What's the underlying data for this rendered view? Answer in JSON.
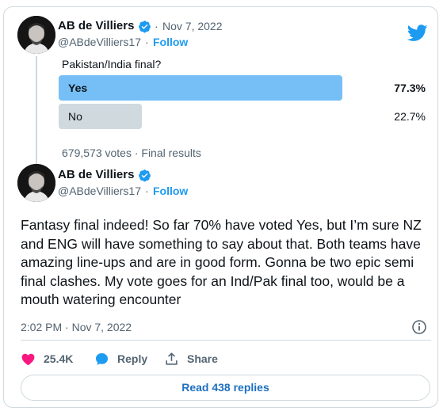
{
  "quoted_tweet": {
    "author_name": "AB de Villiers",
    "handle": "@ABdeVilliers17",
    "date": "Nov 7, 2022",
    "dot": "·",
    "follow_label": "Follow",
    "question": "Pakistan/India final?",
    "poll": {
      "options": [
        {
          "label": "Yes",
          "percent": 77.3,
          "percent_label": "77.3%",
          "winner": true
        },
        {
          "label": "No",
          "percent": 22.7,
          "percent_label": "22.7%",
          "winner": false
        }
      ],
      "votes": "679,573 votes",
      "status": "Final results",
      "meta_line": "679,573 votes · Final results"
    }
  },
  "main_tweet": {
    "author_name": "AB de Villiers",
    "handle": "@ABdeVilliers17",
    "dot": "·",
    "follow_label": "Follow",
    "text": "Fantasy final indeed! So far 70% have voted Yes, but I’m sure NZ and ENG will have something to say about that. Both teams have amazing line-ups and are in good form. Gonna be two epic semi final clashes. My vote goes for an Ind/Pak final too, would be a mouth watering encounter",
    "timestamp": "2:02 PM · Nov 7, 2022"
  },
  "actions": {
    "likes": "25.4K",
    "reply_label": "Reply",
    "share_label": "Share"
  },
  "read_replies_label": "Read 438 replies",
  "colors": {
    "brand_blue": "#1d9bf0",
    "poll_winner": "#76bff6",
    "poll_other": "#cfd9de",
    "like_pink": "#f91880"
  },
  "icons": [
    "twitter-bird-icon",
    "verified-badge-icon",
    "heart-icon",
    "reply-bubble-icon",
    "share-icon",
    "info-icon"
  ]
}
